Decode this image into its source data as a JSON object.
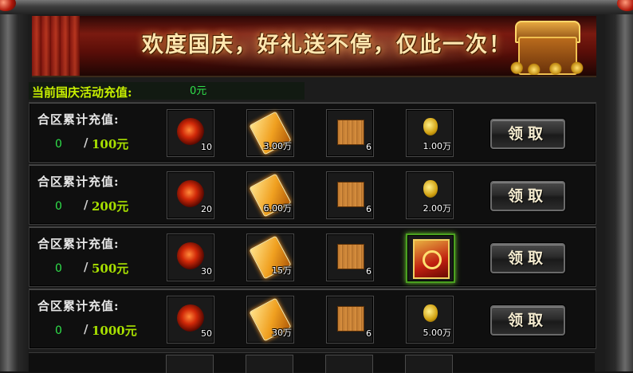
{
  "banner": {
    "title": "欢度国庆，好礼送不停，仅此一次！"
  },
  "total": {
    "label": "当前国庆活动充值:",
    "value": "0元"
  },
  "tiers": [
    {
      "label": "合区累计充值:",
      "current": "0",
      "separator": "/",
      "target": "100元",
      "rewards": [
        {
          "icon": "blood-orb-icon",
          "qty": "10"
        },
        {
          "icon": "gold-scroll-icon",
          "qty": "3.00万"
        },
        {
          "icon": "wooden-crate-icon",
          "qty": "6"
        },
        {
          "icon": "gold-pouch-icon",
          "qty": "1.00万"
        }
      ],
      "claim_label": "领取"
    },
    {
      "label": "合区累计充值:",
      "current": "0",
      "separator": "/",
      "target": "200元",
      "rewards": [
        {
          "icon": "blood-orb-icon",
          "qty": "20"
        },
        {
          "icon": "gold-scroll-icon",
          "qty": "6.00万"
        },
        {
          "icon": "wooden-crate-icon",
          "qty": "6"
        },
        {
          "icon": "gold-pouch-icon",
          "qty": "2.00万"
        }
      ],
      "claim_label": "领取"
    },
    {
      "label": "合区累计充值:",
      "current": "0",
      "separator": "/",
      "target": "500元",
      "rewards": [
        {
          "icon": "blood-orb-icon",
          "qty": "30"
        },
        {
          "icon": "gold-scroll-icon",
          "qty": "15万"
        },
        {
          "icon": "wooden-crate-icon",
          "qty": "6"
        },
        {
          "icon": "rune-card-icon",
          "qty": ""
        }
      ],
      "claim_label": "领取"
    },
    {
      "label": "合区累计充值:",
      "current": "0",
      "separator": "/",
      "target": "1000元",
      "rewards": [
        {
          "icon": "blood-orb-icon",
          "qty": "50"
        },
        {
          "icon": "gold-scroll-icon",
          "qty": "30万"
        },
        {
          "icon": "wooden-crate-icon",
          "qty": "6"
        },
        {
          "icon": "gold-pouch-icon",
          "qty": "5.00万"
        }
      ],
      "claim_label": "领取"
    }
  ],
  "colors": {
    "total_label": "#c8f000",
    "current_value": "#2fe04a",
    "target_value": "#a8e000",
    "banner_text": "#ffe7b0"
  }
}
